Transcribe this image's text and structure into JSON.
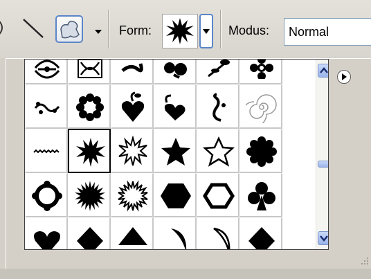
{
  "options_bar": {
    "form_label": "Form:",
    "modus_label": "Modus:",
    "modus_value": "Normal",
    "icons": [
      "ellipse-tool-icon",
      "line-tool-icon",
      "custom-shape-tool-icon",
      "chevron-down-icon"
    ]
  },
  "shape_picker": {
    "selected": "star-burst-12",
    "shapes": [
      "ornament-1",
      "ornament-2",
      "ornament-3",
      "ornament-4",
      "ornament-5",
      "ornament-6",
      "flourish-1",
      "flower-8",
      "heart-ornament",
      "leaf-heart",
      "flourish-2",
      "spiral",
      "sawtooth-line",
      "star-burst-12",
      "star-burst-outline",
      "star-filled",
      "star-outline",
      "scallop-circle",
      "scallop-ring",
      "sun-burst",
      "sun-burst-outline",
      "hexagon-filled",
      "hexagon-outline",
      "club",
      "heart",
      "diamond-1",
      "triangle-1",
      "moon-1",
      "moon-2",
      "diamond-2"
    ]
  },
  "colors": {
    "accent": "#5a85c8",
    "panel_bg": "#d4d0c8",
    "scroll_btn": "#9ab4ea"
  }
}
